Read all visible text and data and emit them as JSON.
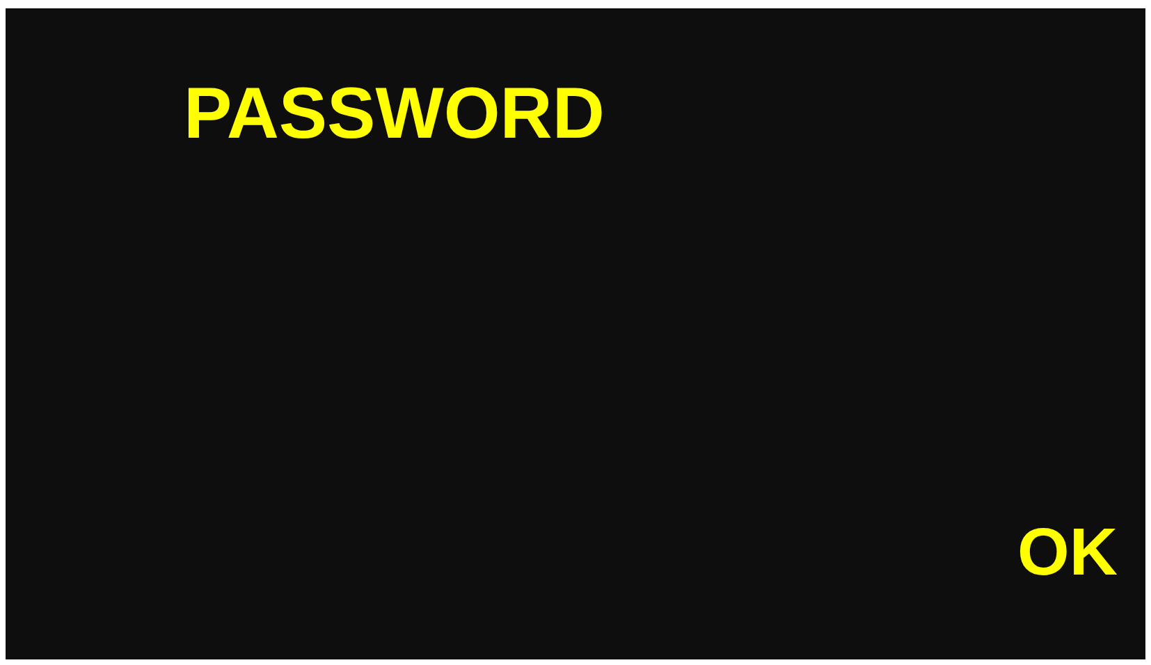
{
  "title": "PASSWORD",
  "ok_button": {
    "label": "OK"
  }
}
